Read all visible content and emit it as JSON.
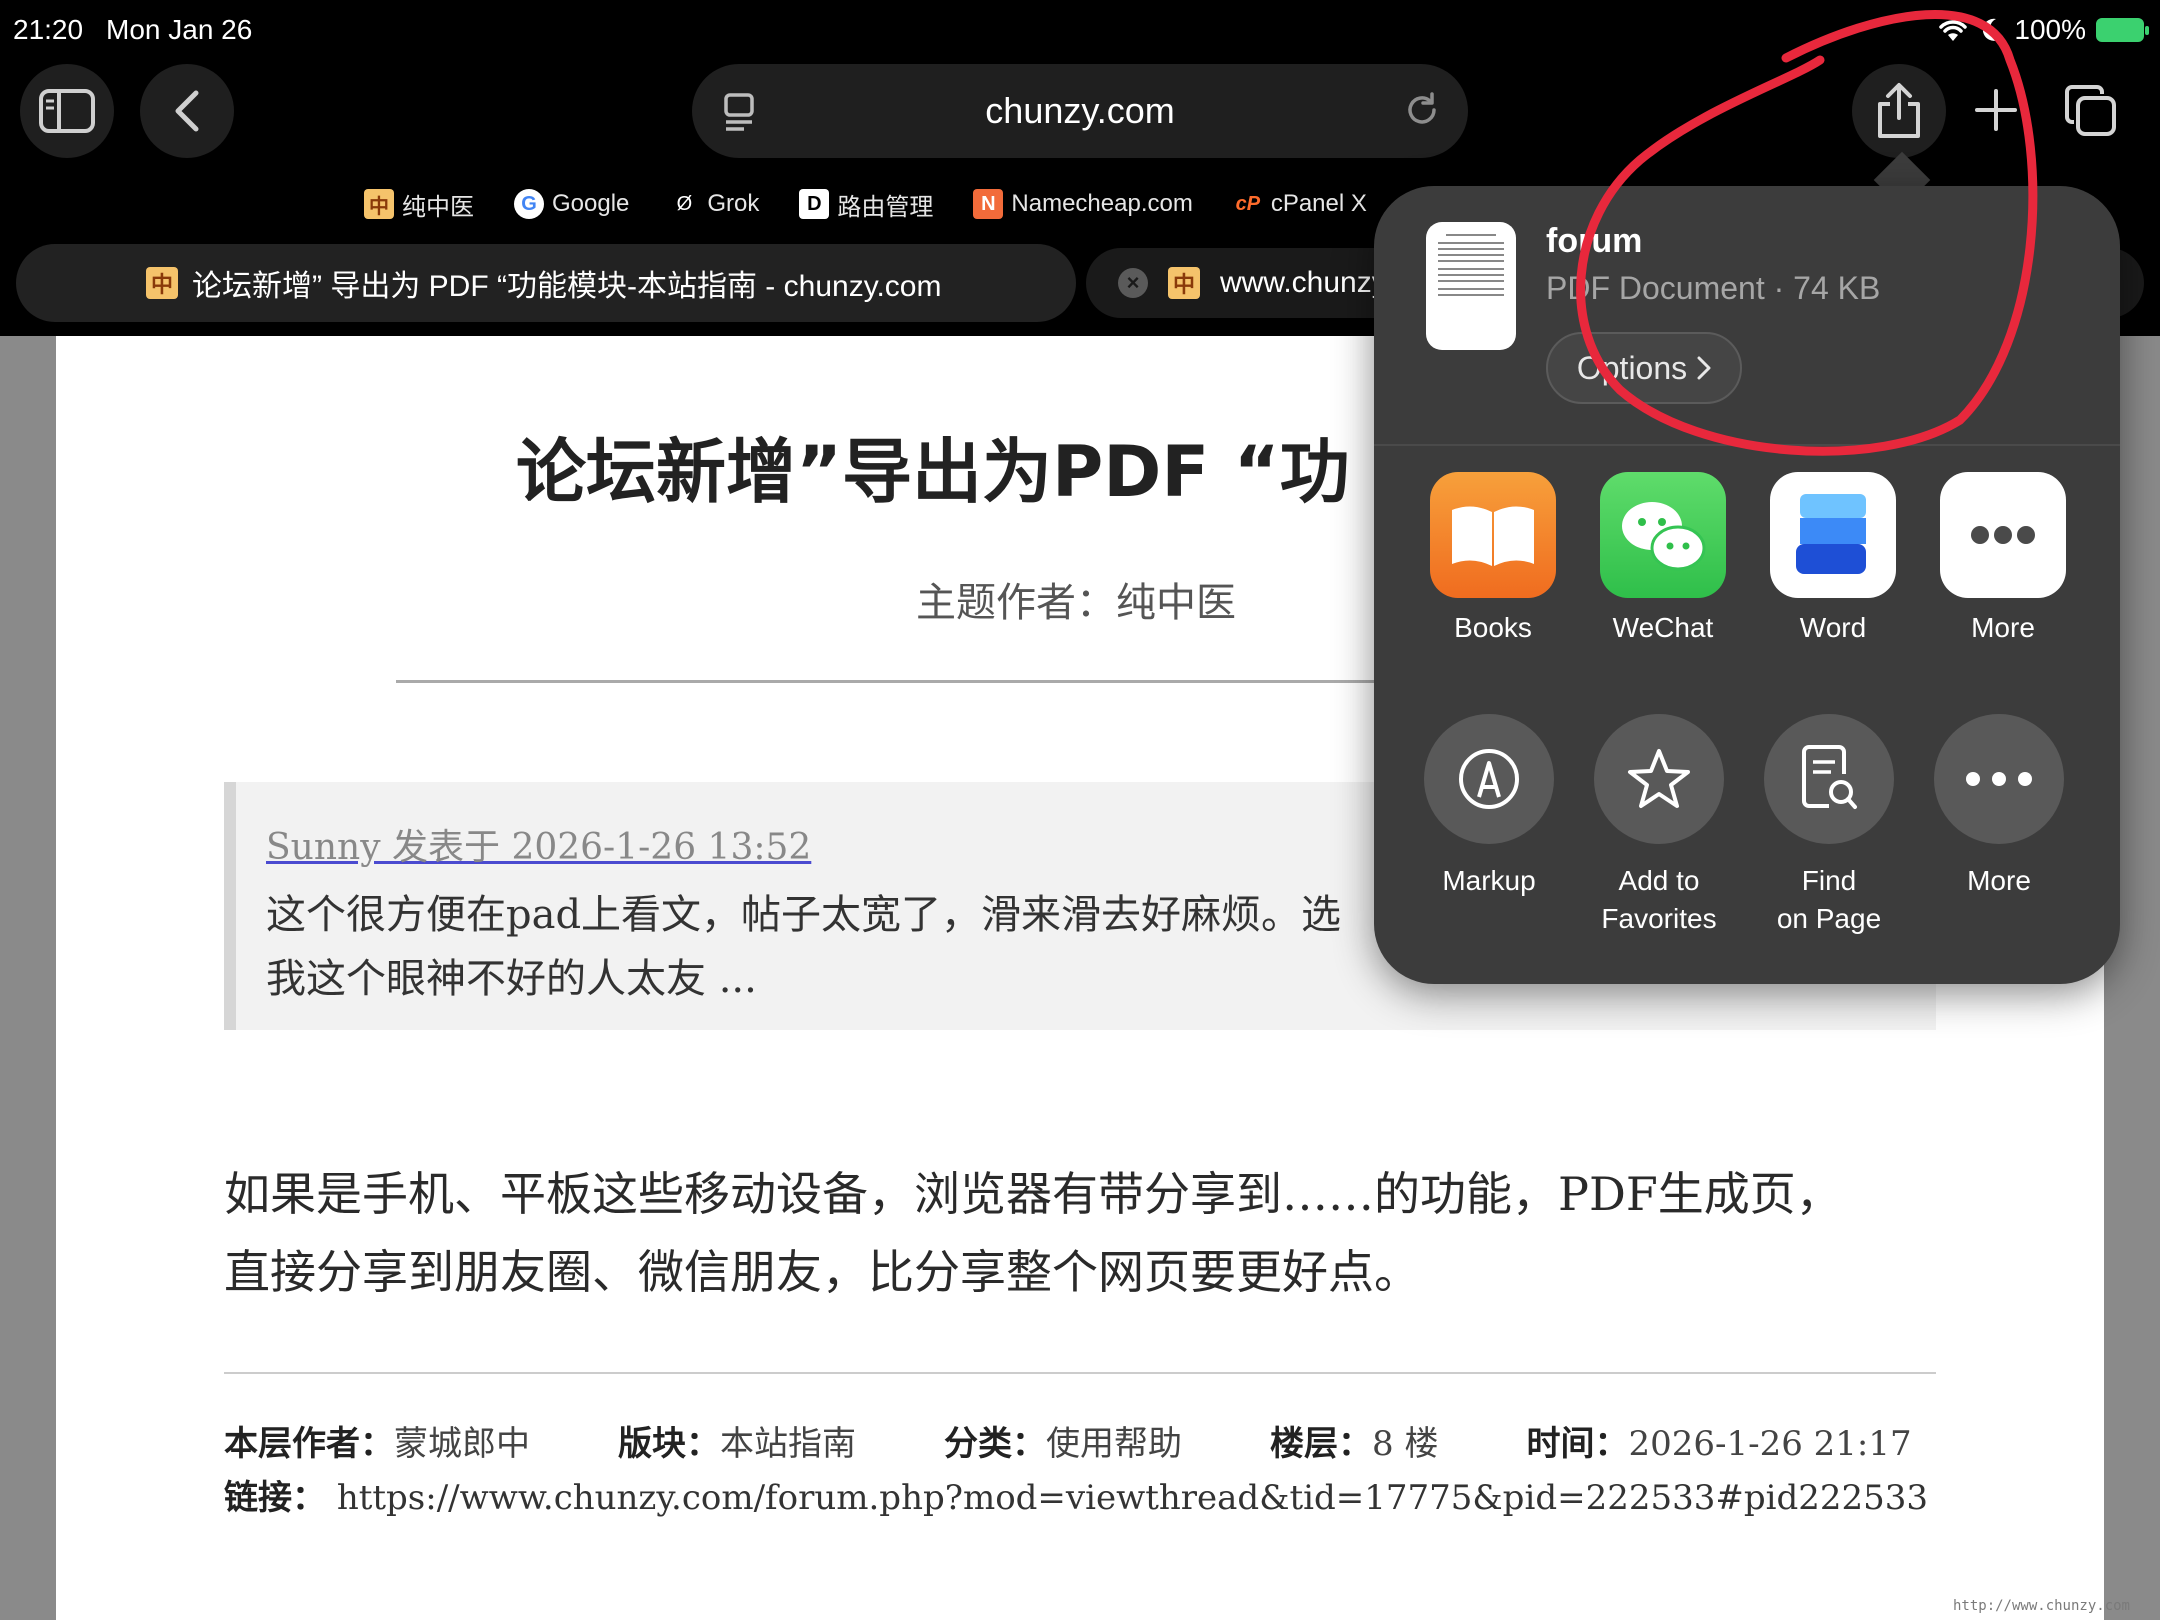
{
  "status": {
    "time": "21:20",
    "date": "Mon Jan 26",
    "battery": "100%"
  },
  "browser": {
    "url": "chunzy.com",
    "bookmarks": [
      {
        "label": "纯中医",
        "icon": "chunzy-favicon"
      },
      {
        "label": "Google",
        "icon": "google-icon"
      },
      {
        "label": "Grok",
        "icon": "grok-icon"
      },
      {
        "label": "路由管理",
        "icon": "router-icon"
      },
      {
        "label": "Namecheap.com",
        "icon": "namecheap-icon"
      },
      {
        "label": "cPanel X",
        "icon": "cpanel-icon"
      }
    ],
    "tabs": [
      {
        "title": "论坛新增” 导出为 PDF “功能模块-本站指南 - chunzy.com",
        "active": true
      },
      {
        "title": "www.chunzy",
        "active": false
      }
    ]
  },
  "page": {
    "title": "论坛新增”导出为PDF “功",
    "author": "主题作者：纯中医",
    "quote": {
      "meta": "Sunny 发表于 2026-1-26 13:52",
      "line1": "这个很方便在pad上看文，帖子太宽了，滑来滑去好麻烦。选",
      "line2": "我这个眼神不好的人太友 ..."
    },
    "body_line1": "如果是手机、平板这些移动设备，浏览器有带分享到……的功能，PDF生成页，",
    "body_line2": "直接分享到朋友圈、微信朋友，比分享整个网页要更好点。",
    "footer": {
      "author_label": "本层作者：",
      "author": "蒙城郎中",
      "board_label": "版块：",
      "board": "本站指南",
      "category_label": "分类：",
      "category": "使用帮助",
      "floor_label": "楼层：",
      "floor": "8 楼",
      "time_label": "时间：",
      "time": "2026-1-26 21:17",
      "link_label": "链接：",
      "link": "https://www.chunzy.com/forum.php?mod=viewthread&tid=17775&pid=222533#pid222533"
    },
    "watermark": "http://www.chunzy.com"
  },
  "share": {
    "doc_name": "forum",
    "doc_info": "PDF Document · 74 KB",
    "options_label": "Options",
    "apps": [
      {
        "label": "Books",
        "icon": "books-icon"
      },
      {
        "label": "WeChat",
        "icon": "wechat-icon"
      },
      {
        "label": "Word",
        "icon": "word-icon"
      },
      {
        "label": "More",
        "icon": "more-icon"
      }
    ],
    "actions": [
      {
        "label": "Markup",
        "icon": "markup-icon"
      },
      {
        "label": "Add to\nFavorites",
        "line1": "Add to",
        "line2": "Favorites",
        "icon": "star-icon"
      },
      {
        "label": "Find\non Page",
        "line1": "Find",
        "line2": "on Page",
        "icon": "find-on-page-icon"
      },
      {
        "label": "More",
        "icon": "more-icon"
      }
    ]
  },
  "colors": {
    "annotation": "#e8283c",
    "battery": "#3bd16f",
    "sheet": "#3c3c3c"
  }
}
